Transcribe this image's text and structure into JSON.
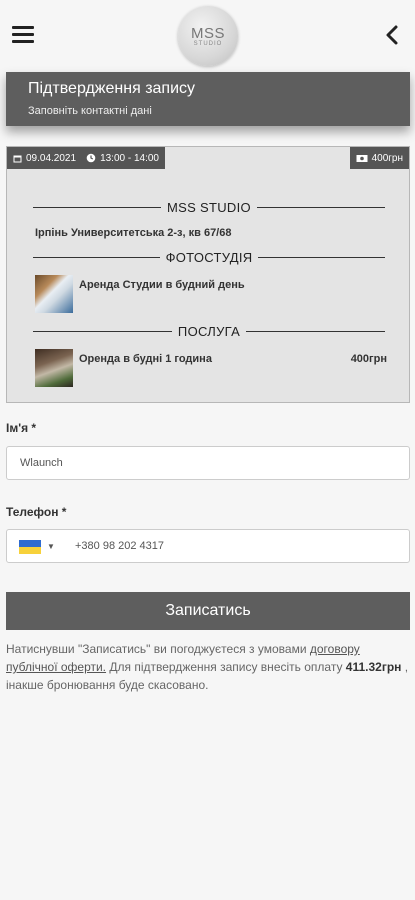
{
  "header": {
    "logo_main": "MSS",
    "logo_sub": "STUDIO"
  },
  "page": {
    "title": "Підтвердження запису",
    "subtitle": "Заповніть контактні дані"
  },
  "booking": {
    "date": "09.04.2021",
    "time": "13:00 - 14:00",
    "total_chip": "400грн",
    "studio_name": "MSS STUDIO",
    "address": "Ірпінь Университетська 2-з, кв 67/68",
    "photostudio_heading": "ФОТОСТУДІЯ",
    "photostudio_item": "Аренда Студии в будний день",
    "service_heading": "ПОСЛУГА",
    "service_item": "Оренда в будні 1 година",
    "service_price": "400грн"
  },
  "form": {
    "name_label": "Ім'я *",
    "name_value": "Wlaunch",
    "phone_label": "Телефон *",
    "phone_value": "+380 98 202 4317",
    "submit_label": "Записатись"
  },
  "terms": {
    "text_1": "Натиснувши \"Записатись\" ви погоджуєтеся з умовами ",
    "link": "договору публічної оферти.",
    "text_2": " Для підтвердження запису внесіть оплату ",
    "amount": "411.32грн",
    "text_3": ", інакше бронювання буде скасовано."
  },
  "colors": {
    "header_bg": "#5e5e5e",
    "card_bg": "#e4e4e4",
    "flag_blue": "#2f6bd0",
    "flag_yellow": "#f7d13a"
  }
}
